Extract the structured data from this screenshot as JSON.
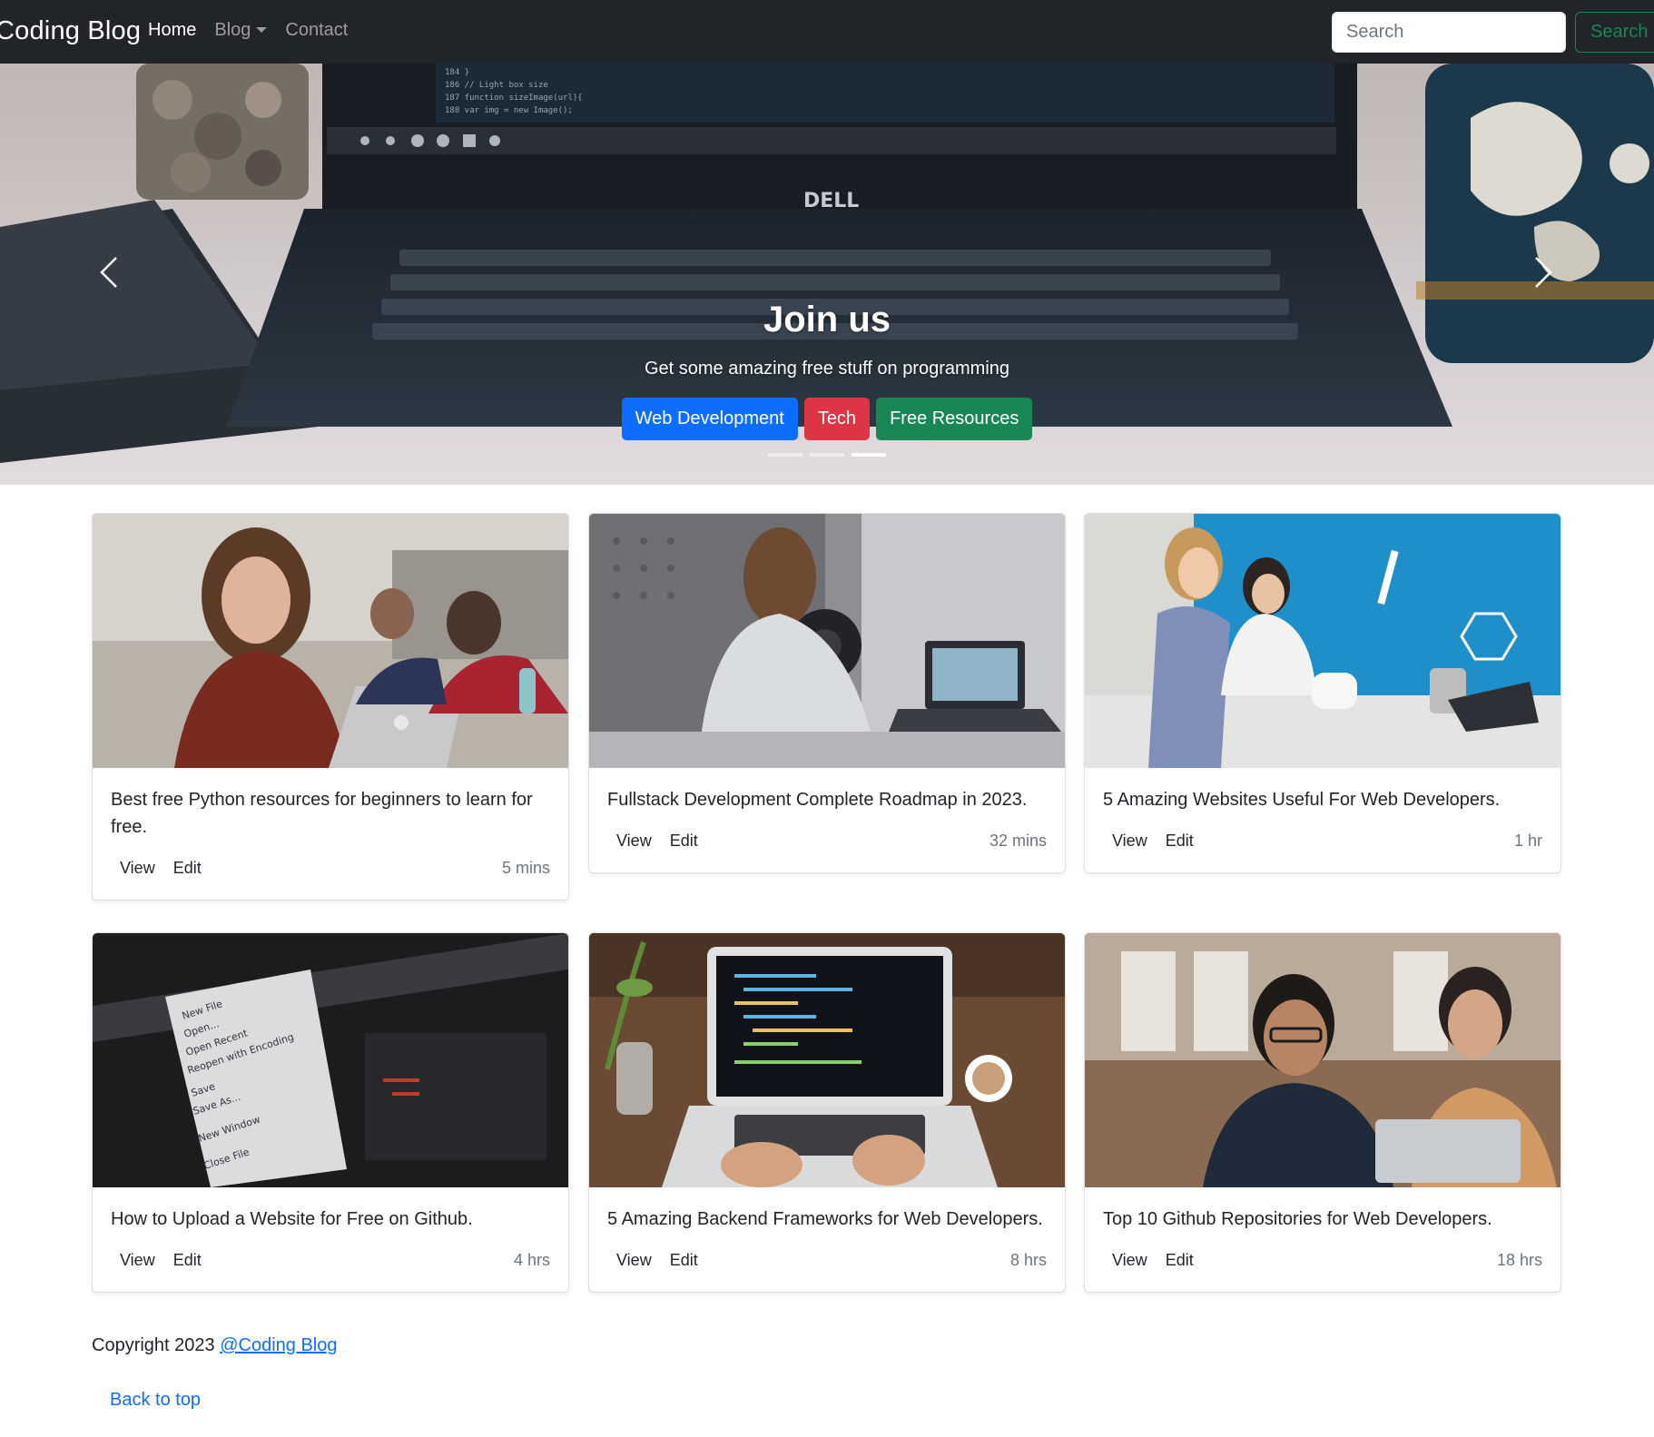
{
  "navbar": {
    "brand": "Coding Blog",
    "links": [
      {
        "label": "Home",
        "active": true
      },
      {
        "label": "Blog",
        "dropdown": true
      },
      {
        "label": "Contact"
      }
    ],
    "search": {
      "placeholder": "Search",
      "button_label": "Search"
    }
  },
  "hero": {
    "title": "Join us",
    "subtitle": "Get some amazing free stuff on programming",
    "buttons": [
      {
        "label": "Web Development",
        "color": "#0d6efd"
      },
      {
        "label": "Tech",
        "color": "#dc3545"
      },
      {
        "label": "Free Resources",
        "color": "#198754"
      }
    ],
    "indicator_count": 3,
    "active_indicator": 3
  },
  "cards": [
    {
      "text": "Best free Python resources for beginners to learn for free.",
      "view": "View",
      "edit": "Edit",
      "time": "5 mins"
    },
    {
      "text": "Fullstack Development Complete Roadmap in 2023.",
      "view": "View",
      "edit": "Edit",
      "time": "32 mins"
    },
    {
      "text": "5 Amazing Websites Useful For Web Developers.",
      "view": "View",
      "edit": "Edit",
      "time": "1 hr"
    },
    {
      "text": "How to Upload a Website for Free on Github.",
      "view": "View",
      "edit": "Edit",
      "time": "4 hrs"
    },
    {
      "text": "5 Amazing Backend Frameworks for Web Developers.",
      "view": "View",
      "edit": "Edit",
      "time": "8 hrs"
    },
    {
      "text": "Top 10 Github Repositories for Web Developers.",
      "view": "View",
      "edit": "Edit",
      "time": "18 hrs"
    }
  ],
  "footer": {
    "copyright": "Copyright 2023",
    "link": "@Coding Blog",
    "back_to_top": "Back to top"
  }
}
